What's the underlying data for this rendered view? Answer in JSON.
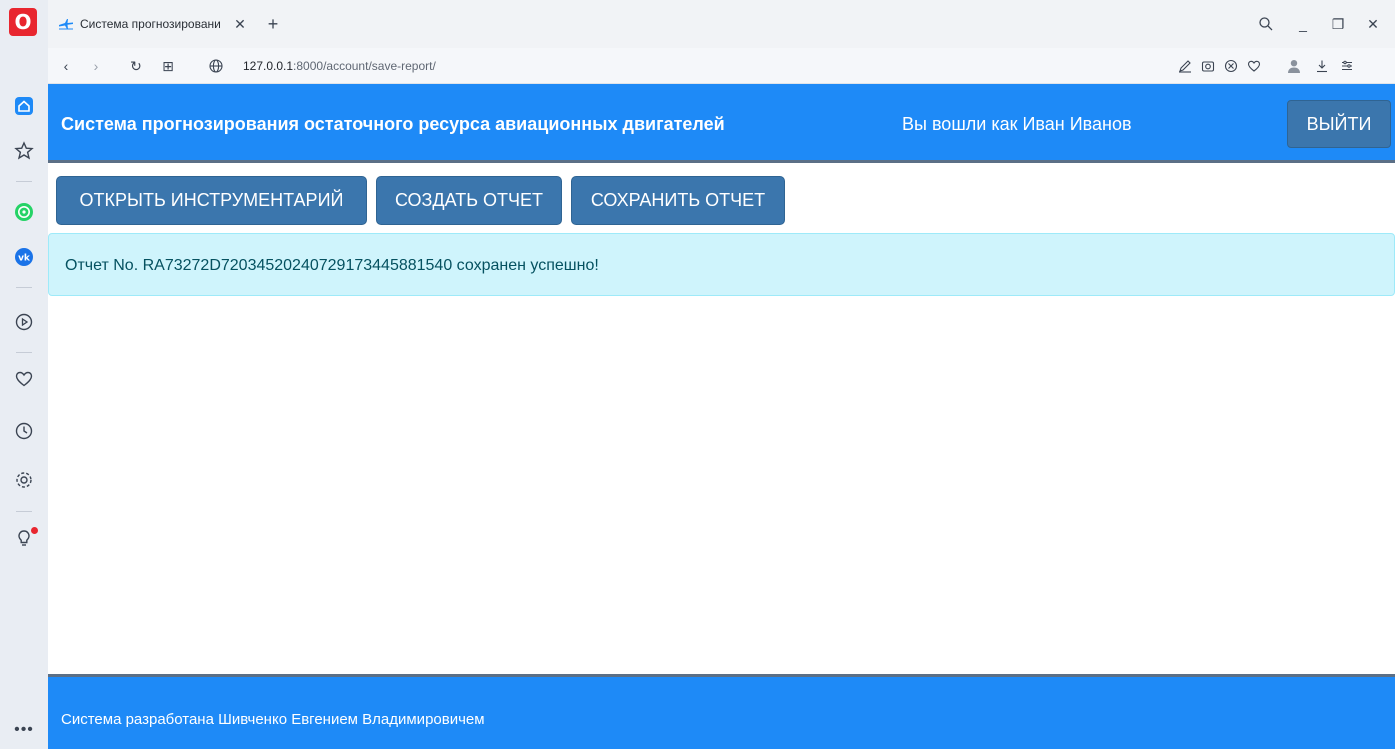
{
  "browser": {
    "tab": {
      "title": "Система прогнозировани",
      "close_glyph": "✕"
    },
    "new_tab_glyph": "+",
    "window_controls": {
      "search_glyph": "⌕",
      "minimize_glyph": "_",
      "restore_glyph": "❐",
      "close_glyph": "✕"
    },
    "nav": {
      "back_glyph": "‹",
      "forward_glyph": "›",
      "reload_glyph": "↻",
      "tabs_grid_glyph": "⊞"
    },
    "url": {
      "host": "127.0.0.1",
      "rest": ":8000/account/save-report/"
    },
    "sidebar": {
      "logo": "O",
      "items": [
        "home-icon",
        "bookmarks-star-icon",
        "whatsapp-icon",
        "vk-icon",
        "player-icon",
        "heart-icon",
        "history-clock-icon",
        "settings-gear-icon",
        "tips-bulb-icon"
      ],
      "more": "•••"
    }
  },
  "header": {
    "title": "Система прогнозирования остаточного ресурса авиационных двигателей",
    "logged_in_as": "Вы вошли как Иван Иванов",
    "logout_label": "ВЫЙТИ"
  },
  "actions": {
    "open_tools": "ОТКРЫТЬ ИНСТРУМЕНТАРИЙ",
    "create_report": "СОЗДАТЬ ОТЧЕТ",
    "save_report": "СОХРАНИТЬ ОТЧЕТ"
  },
  "alert": {
    "message": "Отчет No. RA73272D7203452024072917344588154​0 сохранен успешно!"
  },
  "footer": {
    "text": "Система разработана Шивченко Евгением Владимировичем"
  },
  "colors": {
    "primary": "#1e8af7",
    "button": "#3b76ad",
    "alert_bg": "#cff4fc",
    "alert_text": "#055160",
    "opera_red": "#e8262f"
  }
}
